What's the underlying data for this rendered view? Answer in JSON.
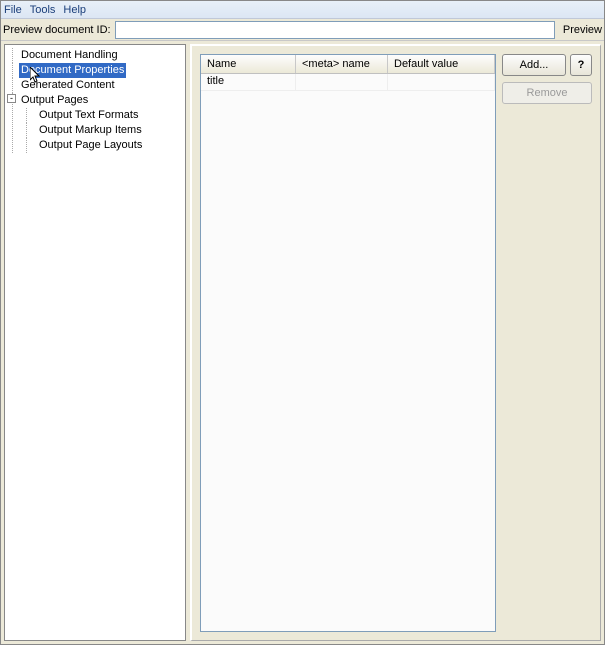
{
  "menubar": {
    "items": [
      "File",
      "Tools",
      "Help"
    ]
  },
  "toolbar": {
    "label": "Preview document ID:",
    "value": "",
    "preview_label": "Preview"
  },
  "tree": {
    "items": [
      {
        "label": "Document Handling"
      },
      {
        "label": "Document Properties",
        "selected": true
      },
      {
        "label": "Generated Content"
      },
      {
        "label": "Output Pages",
        "expanded": true,
        "children": [
          {
            "label": "Output Text Formats"
          },
          {
            "label": "Output Markup Items"
          },
          {
            "label": "Output Page Layouts"
          }
        ]
      }
    ]
  },
  "table": {
    "columns": [
      "Name",
      "<meta> name",
      "Default value"
    ],
    "rows": [
      {
        "name": "title",
        "meta": "",
        "default": ""
      }
    ]
  },
  "buttons": {
    "add": "Add...",
    "help": "?",
    "remove": "Remove"
  }
}
